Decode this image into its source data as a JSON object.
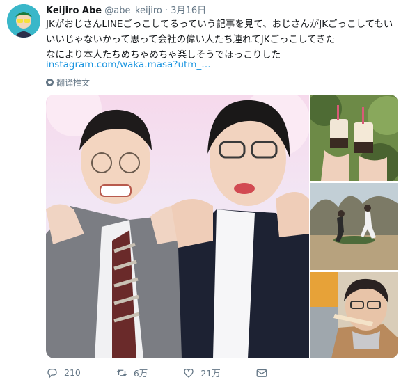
{
  "tweet": {
    "name": "Keijiro Abe",
    "handle": "@abe_keijiro",
    "separator": "·",
    "date": "3月16日",
    "lines": [
      "JKがおじさんLINEごっこしてるっていう記事を見て、おじさんがJKごっこしてもい",
      "いいじゃないかって思って会社の偉い人たち連れてJKごっこしてきた",
      "なにより本人たちめちゃめちゃ楽しそうでほっこりした"
    ],
    "link": "instagram.com/waka.masa?utm_…",
    "translate_label": "翻译推文"
  },
  "actions": {
    "reply_count": "210",
    "retweet_count": "6万",
    "like_count": "21万"
  },
  "icons": {
    "reply": "reply-icon",
    "retweet": "retweet-icon",
    "like": "heart-icon",
    "dm": "mail-icon",
    "translate": "globe-icon"
  },
  "colors": {
    "link": "#1b95e0",
    "muted": "#657786",
    "text": "#14171a"
  }
}
